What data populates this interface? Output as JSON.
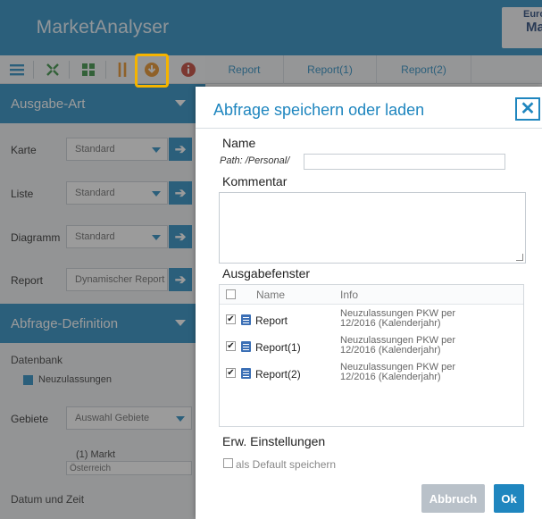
{
  "app": {
    "title": "MarketAnalyser"
  },
  "logo": {
    "line1": "Euro",
    "line2": "Ma"
  },
  "toolbar": {
    "icons": [
      "list-icon",
      "collapse-arrows-icon",
      "grid-icon",
      "sort-icon",
      "save-load-icon",
      "info-icon"
    ]
  },
  "tabs": [
    "Report",
    "Report(1)",
    "Report(2)"
  ],
  "sidebar": {
    "ausgabe_art": {
      "title": "Ausgabe-Art",
      "rows": [
        {
          "label": "Karte",
          "value": "Standard"
        },
        {
          "label": "Liste",
          "value": "Standard"
        },
        {
          "label": "Diagramm",
          "value": "Standard"
        },
        {
          "label": "Report",
          "value": "Dynamischer Report"
        }
      ]
    },
    "abfrage_definition": {
      "title": "Abfrage-Definition",
      "datenbank_label": "Datenbank",
      "datenbank_value": "Neuzulassungen",
      "gebiete_label": "Gebiete",
      "gebiete_value": "Auswahl Gebiete",
      "markt_label": "(1) Markt",
      "markt_value": "Österreich",
      "datum_label": "Datum und Zeit"
    }
  },
  "dialog": {
    "title": "Abfrage speichern oder laden",
    "name_label": "Name",
    "path_text": "Path: /Personal/",
    "name_value": "",
    "comment_label": "Kommentar",
    "comment_value": "",
    "output_label": "Ausgabefenster",
    "grid_headers": {
      "name": "Name",
      "info": "Info"
    },
    "grid_rows": [
      {
        "checked": true,
        "name": "Report",
        "info": "Neuzulassungen PKW per 12/2016 (Kalenderjahr)"
      },
      {
        "checked": true,
        "name": "Report(1)",
        "info": "Neuzulassungen PKW per 12/2016 (Kalenderjahr)"
      },
      {
        "checked": true,
        "name": "Report(2)",
        "info": "Neuzulassungen PKW per 12/2016 (Kalenderjahr)"
      }
    ],
    "advanced_label": "Erw. Einstellungen",
    "default_label": "als Default speichern",
    "default_checked": false,
    "cancel_label": "Abbruch",
    "ok_label": "Ok"
  },
  "colors": {
    "accent": "#1f86bf",
    "highlight": "#f5b400",
    "cancel": "#b9c1c9"
  }
}
